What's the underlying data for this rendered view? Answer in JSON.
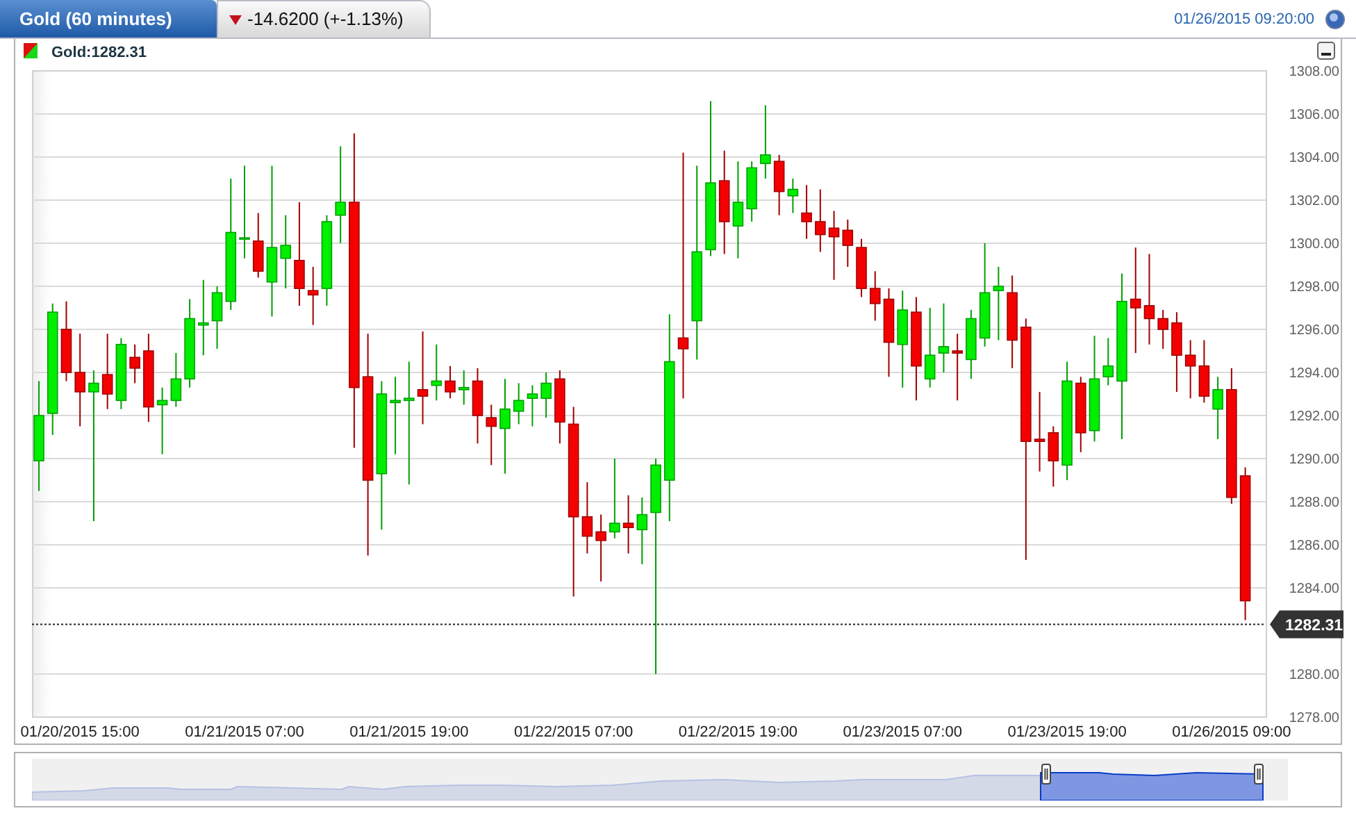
{
  "header": {
    "title": "Gold (60 minutes)",
    "change": "-14.6200 (+-1.13%)",
    "falling": true,
    "timestamp": "01/26/2015 09:20:00"
  },
  "legend": {
    "label": "Gold:1282.31"
  },
  "chart": {
    "chart_data": {
      "type": "candlestick",
      "ylim": [
        1278,
        1308
      ],
      "grid": true,
      "ref_lines": [
        {
          "axis": "y",
          "value": 1282.31,
          "label": "1282.31",
          "color": "#222222"
        }
      ],
      "yticks": [
        {
          "value": 1308,
          "label": "1308.00"
        },
        {
          "value": 1306,
          "label": "1306.00"
        },
        {
          "value": 1304,
          "label": "1304.00"
        },
        {
          "value": 1302,
          "label": "1302.00"
        },
        {
          "value": 1300,
          "label": "1300.00"
        },
        {
          "value": 1298,
          "label": "1298.00"
        },
        {
          "value": 1296,
          "label": "1296.00"
        },
        {
          "value": 1294,
          "label": "1294.00"
        },
        {
          "value": 1292,
          "label": "1292.00"
        },
        {
          "value": 1290,
          "label": "1290.00"
        },
        {
          "value": 1288,
          "label": "1288.00"
        },
        {
          "value": 1286,
          "label": "1286.00"
        },
        {
          "value": 1284,
          "label": "1284.00"
        },
        {
          "value": 1280,
          "label": "1280.00"
        },
        {
          "value": 1278,
          "label": "1278.00"
        }
      ],
      "categories": [
        null,
        null,
        null,
        "01/20/2015 15:00",
        null,
        null,
        null,
        null,
        null,
        null,
        null,
        null,
        null,
        null,
        null,
        "01/21/2015 07:00",
        null,
        null,
        null,
        null,
        null,
        null,
        null,
        null,
        null,
        null,
        null,
        "01/21/2015 19:00",
        null,
        null,
        null,
        null,
        null,
        null,
        null,
        null,
        null,
        null,
        null,
        "01/22/2015 07:00",
        null,
        null,
        null,
        null,
        null,
        null,
        null,
        null,
        null,
        null,
        null,
        "01/22/2015 19:00",
        null,
        null,
        null,
        null,
        null,
        null,
        null,
        null,
        null,
        null,
        null,
        "01/23/2015 07:00",
        null,
        null,
        null,
        null,
        null,
        null,
        null,
        null,
        null,
        null,
        null,
        "01/23/2015 19:00",
        null,
        null,
        null,
        null,
        null,
        null,
        null,
        null,
        null,
        null,
        null,
        "01/26/2015 09:00",
        null
      ],
      "ohlc": [
        [
          1289.9,
          1293.6,
          1288.5,
          1292.0
        ],
        [
          1292.1,
          1297.2,
          1291.1,
          1296.8
        ],
        [
          1296.0,
          1297.3,
          1293.6,
          1294.0
        ],
        [
          1294.0,
          1295.8,
          1291.5,
          1293.1
        ],
        [
          1293.1,
          1294.1,
          1287.1,
          1293.5
        ],
        [
          1293.9,
          1295.8,
          1292.3,
          1293.0
        ],
        [
          1292.7,
          1295.6,
          1292.3,
          1295.3
        ],
        [
          1294.7,
          1295.3,
          1293.5,
          1294.2
        ],
        [
          1295.0,
          1295.8,
          1291.7,
          1292.4
        ],
        [
          1292.5,
          1293.3,
          1290.2,
          1292.7
        ],
        [
          1292.7,
          1294.9,
          1292.4,
          1293.7
        ],
        [
          1293.7,
          1297.4,
          1293.3,
          1296.5
        ],
        [
          1296.2,
          1298.3,
          1294.8,
          1296.3
        ],
        [
          1296.4,
          1298.0,
          1295.1,
          1297.7
        ],
        [
          1297.3,
          1303.0,
          1296.9,
          1300.5
        ],
        [
          1300.2,
          1303.6,
          1299.3,
          1300.25
        ],
        [
          1300.1,
          1301.4,
          1298.4,
          1298.7
        ],
        [
          1298.2,
          1303.6,
          1296.6,
          1299.8
        ],
        [
          1299.3,
          1301.3,
          1297.9,
          1299.9
        ],
        [
          1299.2,
          1301.9,
          1297.1,
          1297.9
        ],
        [
          1297.8,
          1298.9,
          1296.2,
          1297.6
        ],
        [
          1297.9,
          1301.3,
          1297.1,
          1301.0
        ],
        [
          1301.3,
          1304.5,
          1300.0,
          1301.9
        ],
        [
          1301.9,
          1305.1,
          1290.5,
          1293.3
        ],
        [
          1293.8,
          1295.8,
          1285.5,
          1289.0
        ],
        [
          1289.3,
          1293.6,
          1286.7,
          1293.0
        ],
        [
          1292.6,
          1293.8,
          1290.2,
          1292.7
        ],
        [
          1292.7,
          1294.5,
          1288.8,
          1292.8
        ],
        [
          1293.2,
          1295.9,
          1291.6,
          1292.9
        ],
        [
          1293.4,
          1295.3,
          1292.7,
          1293.6
        ],
        [
          1293.6,
          1294.3,
          1292.8,
          1293.1
        ],
        [
          1293.2,
          1294.1,
          1292.5,
          1293.3
        ],
        [
          1293.6,
          1294.2,
          1290.7,
          1292.0
        ],
        [
          1291.9,
          1292.5,
          1289.7,
          1291.5
        ],
        [
          1291.4,
          1293.7,
          1289.3,
          1292.3
        ],
        [
          1292.2,
          1293.5,
          1291.6,
          1292.7
        ],
        [
          1292.8,
          1293.4,
          1291.5,
          1293.0
        ],
        [
          1292.8,
          1294.0,
          1291.9,
          1293.5
        ],
        [
          1293.7,
          1294.1,
          1290.7,
          1291.7
        ],
        [
          1291.6,
          1292.4,
          1283.6,
          1287.3
        ],
        [
          1287.3,
          1288.9,
          1285.6,
          1286.4
        ],
        [
          1286.6,
          1287.4,
          1284.3,
          1286.2
        ],
        [
          1286.6,
          1290.0,
          1286.3,
          1287.0
        ],
        [
          1287.0,
          1288.3,
          1285.6,
          1286.8
        ],
        [
          1286.7,
          1288.2,
          1285.1,
          1287.4
        ],
        [
          1287.5,
          1290.0,
          1280.0,
          1289.7
        ],
        [
          1289.0,
          1296.7,
          1287.1,
          1294.5
        ],
        [
          1295.6,
          1304.2,
          1292.8,
          1295.1
        ],
        [
          1296.4,
          1303.6,
          1294.6,
          1299.6
        ],
        [
          1299.7,
          1306.6,
          1299.4,
          1302.8
        ],
        [
          1302.9,
          1304.3,
          1299.5,
          1301.0
        ],
        [
          1300.8,
          1303.8,
          1299.3,
          1301.9
        ],
        [
          1301.6,
          1303.8,
          1301.0,
          1303.5
        ],
        [
          1303.7,
          1306.4,
          1303.0,
          1304.1
        ],
        [
          1303.8,
          1304.1,
          1301.3,
          1302.4
        ],
        [
          1302.2,
          1303.0,
          1301.4,
          1302.5
        ],
        [
          1301.4,
          1302.7,
          1300.2,
          1301.0
        ],
        [
          1301.0,
          1302.5,
          1299.6,
          1300.4
        ],
        [
          1300.7,
          1301.5,
          1298.3,
          1300.3
        ],
        [
          1300.6,
          1301.1,
          1298.9,
          1299.9
        ],
        [
          1299.8,
          1300.2,
          1297.5,
          1297.9
        ],
        [
          1297.9,
          1298.7,
          1296.4,
          1297.2
        ],
        [
          1297.4,
          1297.9,
          1293.8,
          1295.4
        ],
        [
          1295.3,
          1297.8,
          1293.3,
          1296.9
        ],
        [
          1296.8,
          1297.5,
          1292.7,
          1294.3
        ],
        [
          1293.7,
          1297.0,
          1293.3,
          1294.8
        ],
        [
          1294.9,
          1297.2,
          1294.0,
          1295.2
        ],
        [
          1295.0,
          1295.8,
          1292.7,
          1294.9
        ],
        [
          1294.6,
          1296.9,
          1293.7,
          1296.5
        ],
        [
          1295.6,
          1300.0,
          1295.2,
          1297.7
        ],
        [
          1297.8,
          1298.9,
          1295.5,
          1298.0
        ],
        [
          1297.7,
          1298.5,
          1294.2,
          1295.5
        ],
        [
          1296.1,
          1296.5,
          1285.3,
          1290.8
        ],
        [
          1290.9,
          1293.1,
          1289.4,
          1290.8
        ],
        [
          1291.2,
          1291.5,
          1288.7,
          1289.9
        ],
        [
          1289.7,
          1294.5,
          1289.0,
          1293.6
        ],
        [
          1293.5,
          1293.8,
          1290.3,
          1291.2
        ],
        [
          1291.3,
          1295.7,
          1290.8,
          1293.7
        ],
        [
          1293.8,
          1295.6,
          1293.4,
          1294.3
        ],
        [
          1293.6,
          1298.6,
          1290.9,
          1297.3
        ],
        [
          1297.4,
          1299.8,
          1294.9,
          1297.0
        ],
        [
          1297.1,
          1299.5,
          1295.3,
          1296.5
        ],
        [
          1296.5,
          1296.9,
          1295.1,
          1296.0
        ],
        [
          1296.3,
          1296.8,
          1293.1,
          1294.8
        ],
        [
          1294.8,
          1295.5,
          1292.8,
          1294.3
        ],
        [
          1294.3,
          1295.5,
          1292.6,
          1292.9
        ],
        [
          1292.3,
          1293.8,
          1290.9,
          1293.2
        ],
        [
          1293.2,
          1294.2,
          1287.9,
          1288.2
        ],
        [
          1289.2,
          1289.6,
          1282.5,
          1283.4
        ]
      ]
    }
  }
}
